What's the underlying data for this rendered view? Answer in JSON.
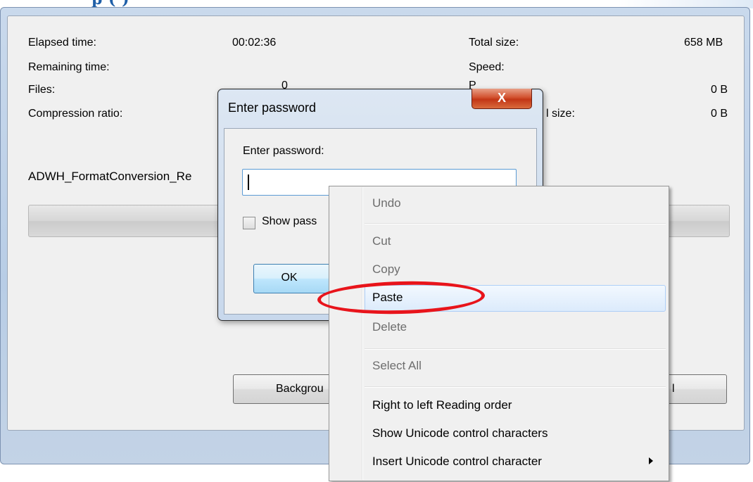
{
  "heading": {
    "text": "p                                                                          (          )"
  },
  "progress_window": {
    "stats_left": [
      {
        "label": "Elapsed time:",
        "value": "00:02:36"
      },
      {
        "label": "Remaining time:",
        "value": ""
      },
      {
        "label": "Files:",
        "value": "0"
      },
      {
        "label": "Compression ratio:",
        "value": ""
      }
    ],
    "stats_right": [
      {
        "label": "Total size:",
        "value": "658 MB"
      },
      {
        "label": "Speed:",
        "value": ""
      },
      {
        "label": "P",
        "value": "0 B"
      },
      {
        "label": "l size:",
        "value": "0 B"
      }
    ],
    "current_file": "ADWH_FormatConversion_Re",
    "progress_fraction": 0.0,
    "button_background": "Backgrou",
    "button_right": "l"
  },
  "password_dialog": {
    "title": "Enter password",
    "close_glyph": "X",
    "prompt_label": "Enter password:",
    "password_value": "",
    "show_password_label": "Show pass",
    "show_password_checked": false,
    "ok_label": "OK"
  },
  "context_menu": {
    "items": [
      {
        "label": "Undo",
        "enabled": false
      },
      {
        "label": "Cut",
        "enabled": false
      },
      {
        "label": "Copy",
        "enabled": false
      },
      {
        "label": "Paste",
        "enabled": true,
        "highlighted": true
      },
      {
        "label": "Delete",
        "enabled": false
      },
      {
        "label": "Select All",
        "enabled": false
      },
      {
        "label": "Right to left Reading order",
        "enabled": true
      },
      {
        "label": "Show Unicode control characters",
        "enabled": true
      },
      {
        "label": "Insert Unicode control character",
        "enabled": true,
        "has_submenu": true
      }
    ]
  },
  "annotation": {
    "color": "#e8141b",
    "target": "Paste"
  },
  "colors": {
    "dialog_frame": "#c8d8ec",
    "close_button": "#c23616",
    "ok_focus": "#3c7fb1"
  }
}
